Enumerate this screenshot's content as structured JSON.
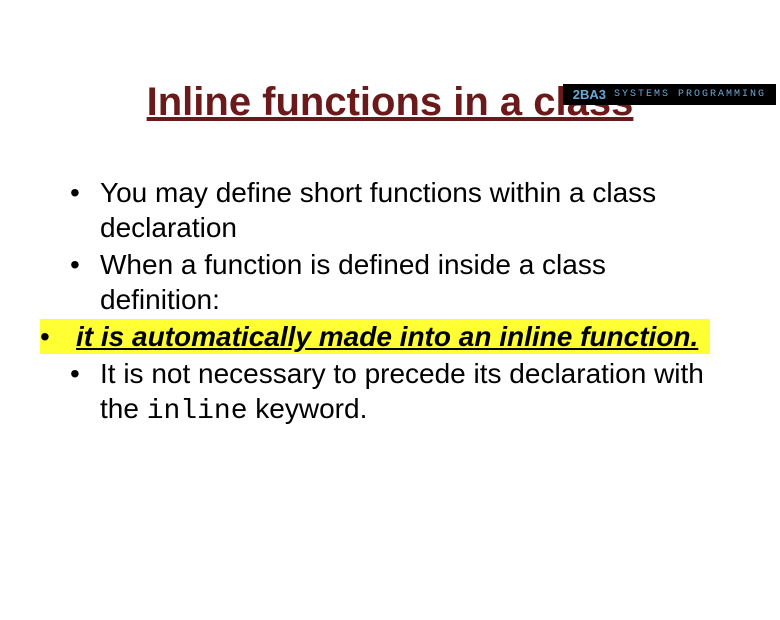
{
  "header": {
    "course": "2BA3",
    "label": "SYSTEMS PROGRAMMING"
  },
  "title": "Inline functions in a class",
  "bullets": {
    "b1": "You may define short functions within a class declaration",
    "b2": "When a function is defined inside a class definition:",
    "b3": "it is automatically made into an inline function.",
    "b4_pre": "It is not necessary to precede its declaration with the ",
    "b4_code": "inline",
    "b4_post": " keyword."
  }
}
